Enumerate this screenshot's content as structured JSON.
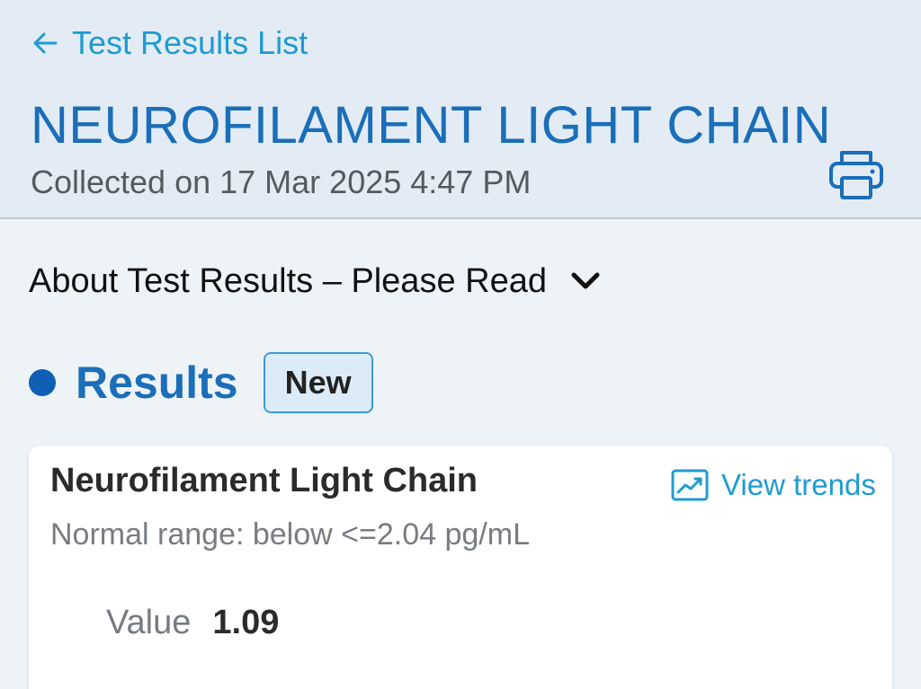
{
  "header": {
    "back_label": "Test Results List",
    "title": "NEUROFILAMENT LIGHT CHAIN",
    "collected": "Collected on 17 Mar 2025 4:47 PM"
  },
  "about": {
    "label": "About Test Results – Please Read"
  },
  "results": {
    "heading": "Results",
    "badge": "New"
  },
  "result_card": {
    "name": "Neurofilament Light Chain",
    "view_trends_label": "View trends",
    "normal_range": "Normal range: below <=2.04 pg/mL",
    "value_label": "Value",
    "value": "1.09"
  },
  "colors": {
    "accent": "#1b6eb8",
    "link": "#1f9bd1",
    "header_bg": "#e3ecf5",
    "page_bg": "#eef3f8"
  },
  "icons": {
    "back": "arrow-left-icon",
    "print": "printer-icon",
    "expand": "chevron-down-icon",
    "trends": "trend-chart-icon"
  }
}
